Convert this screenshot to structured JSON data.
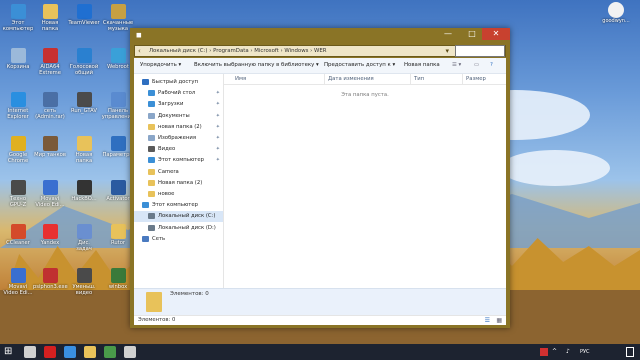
{
  "desktop": {
    "user_label": "goodwyn...",
    "icons": [
      {
        "name": "this-pc",
        "label": "Этот компьютер",
        "color": "#3b8fd6"
      },
      {
        "name": "new-folder",
        "label": "Новая папка",
        "color": "#e8c25a"
      },
      {
        "name": "teamviewer",
        "label": "TeamViewer",
        "color": "#1f6fd1"
      },
      {
        "name": "scrap",
        "label": "Скачанные\nмузыка",
        "color": "#c7a042"
      },
      {
        "name": "recycle",
        "label": "Корзина",
        "color": "#9bb9da"
      },
      {
        "name": "aida",
        "label": "AIDA64\nExtreme",
        "color": "#c73030"
      },
      {
        "name": "cloud",
        "label": "Голосовой\nобщий",
        "color": "#2a80d0"
      },
      {
        "name": "webroot",
        "label": "Webroot",
        "color": "#3aa0d8"
      },
      {
        "name": "ie",
        "label": "Internet\nExplorer",
        "color": "#2a8fe0"
      },
      {
        "name": "net",
        "label": "сеть\n(Admin.rar)",
        "color": "#4a6fa5"
      },
      {
        "name": "run-gta",
        "label": "Run_GTAV",
        "color": "#4b4b4b"
      },
      {
        "name": "panel",
        "label": "Панель\nуправления",
        "color": "#5a8bd0"
      },
      {
        "name": "chrome",
        "label": "Google\nChrome",
        "color": "#e0b020"
      },
      {
        "name": "tanks",
        "label": "Мир танков",
        "color": "#7a5a3a"
      },
      {
        "name": "newfolder2",
        "label": "Новая\nпапка",
        "color": "#e8c25a"
      },
      {
        "name": "settings",
        "label": "Параметры",
        "color": "#2f6fc0"
      },
      {
        "name": "gpuz",
        "label": "Техно\nGPU-Z",
        "color": "#4a4a4a"
      },
      {
        "name": "movavi",
        "label": "Movavi\nVideo Edi...",
        "color": "#3a6fd0"
      },
      {
        "name": "hacks",
        "label": "HackBO...",
        "color": "#333333"
      },
      {
        "name": "activator",
        "label": "Activator",
        "color": "#2a5aa0"
      },
      {
        "name": "ccleaner",
        "label": "CCleaner",
        "color": "#d44a2a"
      },
      {
        "name": "yandex",
        "label": "Yandex",
        "color": "#e83030"
      },
      {
        "name": "dispatcher",
        "label": "Дис.\nзадач",
        "color": "#6a8fd0"
      },
      {
        "name": "rutor",
        "label": "Rutor",
        "color": "#e8c25a"
      },
      {
        "name": "movavi2",
        "label": "Movavi\nVideo Edi...",
        "color": "#3a6fd0"
      },
      {
        "name": "psiphon",
        "label": "psiphon3.exe",
        "color": "#c03030"
      },
      {
        "name": "mkvkey",
        "label": "Уменьш.\nвидео",
        "color": "#4a4a4a"
      },
      {
        "name": "winbox",
        "label": "winbox",
        "color": "#3a7a3a"
      }
    ]
  },
  "window": {
    "title": "",
    "minimize": "—",
    "maximize": "□",
    "close": "✕",
    "address_path": "Локальный диск (C:)  ›  ProgramData  ›  Microsoft  ›  Windows  ›  WER",
    "search_placeholder": ""
  },
  "toolbar": {
    "organize": "Упорядочить ▾",
    "include_library": "Включить выбранную папку в библиотеку ▾",
    "share": "Предоставить доступ к ▾",
    "new_folder": "Новая папка"
  },
  "nav": {
    "items": [
      {
        "label": "Быстрый доступ",
        "level": 0,
        "pinned": false,
        "color": "#2f6fc0",
        "selected": false
      },
      {
        "label": "Рабочий стол",
        "level": 1,
        "pinned": true,
        "color": "#3b8fd6",
        "selected": false
      },
      {
        "label": "Загрузки",
        "level": 1,
        "pinned": true,
        "color": "#3b8fd6",
        "selected": false
      },
      {
        "label": "Документы",
        "level": 1,
        "pinned": true,
        "color": "#8aa6c8",
        "selected": false
      },
      {
        "label": "новая папка (2)",
        "level": 1,
        "pinned": true,
        "color": "#e8c25a",
        "selected": false
      },
      {
        "label": "Изображения",
        "level": 1,
        "pinned": true,
        "color": "#8aa6c8",
        "selected": false
      },
      {
        "label": "Видео",
        "level": 1,
        "pinned": true,
        "color": "#5a5a5a",
        "selected": false
      },
      {
        "label": "Этот компьютер",
        "level": 1,
        "pinned": true,
        "color": "#3b8fd6",
        "selected": false
      },
      {
        "label": "Camera",
        "level": 1,
        "pinned": false,
        "color": "#e8c25a",
        "selected": false
      },
      {
        "label": "Новая папка (2)",
        "level": 1,
        "pinned": false,
        "color": "#e8c25a",
        "selected": false
      },
      {
        "label": "новое",
        "level": 1,
        "pinned": false,
        "color": "#e8c25a",
        "selected": false
      },
      {
        "label": "Этот компьютер",
        "level": 0,
        "pinned": false,
        "color": "#3b8fd6",
        "selected": false
      },
      {
        "label": "Локальный диск (C:)",
        "level": 1,
        "pinned": false,
        "color": "#6a7a8a",
        "selected": true
      },
      {
        "label": "Локальный диск (D:)",
        "level": 1,
        "pinned": false,
        "color": "#6a7a8a",
        "selected": false
      },
      {
        "label": "Сеть",
        "level": 0,
        "pinned": false,
        "color": "#4a7ac0",
        "selected": false
      }
    ]
  },
  "columns": {
    "name": "Имя",
    "date": "Дата изменения",
    "type": "Тип",
    "size": "Размер"
  },
  "content": {
    "empty_text": "Эта папка пуста."
  },
  "details": {
    "elements": "Элементов: 0"
  },
  "status": {
    "elements": "Элементов: 0"
  },
  "taskbar": {
    "tray_text": "РУС",
    "clock": "",
    "apps": [
      {
        "name": "start",
        "color": "#ffffff"
      },
      {
        "name": "search",
        "color": "#d0d0d0"
      },
      {
        "name": "opera",
        "color": "#d42020"
      },
      {
        "name": "edge",
        "color": "#3a8fe0"
      },
      {
        "name": "explorer",
        "color": "#e8c25a"
      },
      {
        "name": "media",
        "color": "#4a9a4a"
      },
      {
        "name": "yandex",
        "color": "#d0d0d0"
      }
    ]
  }
}
